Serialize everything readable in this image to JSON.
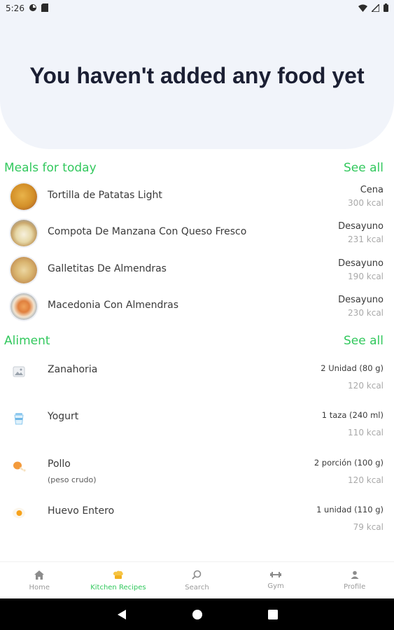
{
  "status_bar": {
    "time": "5:26"
  },
  "hero": {
    "title": "You haven't added any food yet"
  },
  "meals": {
    "title": "Meals for today",
    "see_all": "See all",
    "items": [
      {
        "name": "Tortilla de Patatas Light",
        "type": "Cena",
        "kcal": "300 kcal"
      },
      {
        "name": "Compota De Manzana Con Queso Fresco",
        "type": "Desayuno",
        "kcal": "231 kcal"
      },
      {
        "name": "Galletitas De Almendras",
        "type": "Desayuno",
        "kcal": "190 kcal"
      },
      {
        "name": "Macedonia Con Almendras",
        "type": "Desayuno",
        "kcal": "230 kcal"
      }
    ]
  },
  "aliment": {
    "title": "Aliment",
    "see_all": "See all",
    "items": [
      {
        "name": "Zanahoria",
        "sub": "",
        "portion": "2 Unidad (80 g)",
        "kcal": "120 kcal",
        "icon": "image-placeholder-icon"
      },
      {
        "name": "Yogurt",
        "sub": "",
        "portion": "1 taza (240 ml)",
        "kcal": "110 kcal",
        "icon": "yogurt-cup-icon"
      },
      {
        "name": "Pollo",
        "sub": "(peso crudo)",
        "portion": "2 porción (100 g)",
        "kcal": "120 kcal",
        "icon": "chicken-leg-icon"
      },
      {
        "name": "Huevo Entero",
        "sub": "",
        "portion": "1 unidad (110 g)",
        "kcal": "79 kcal",
        "icon": "egg-icon"
      }
    ]
  },
  "bottom_nav": {
    "items": [
      {
        "label": "Home",
        "icon": "home-icon",
        "active": false
      },
      {
        "label": "Kitchen Recipes",
        "icon": "chef-hat-icon",
        "active": true
      },
      {
        "label": "Search",
        "icon": "search-icon",
        "active": false
      },
      {
        "label": "Gym",
        "icon": "dumbbell-icon",
        "active": false
      },
      {
        "label": "Profile",
        "icon": "person-icon",
        "active": false
      }
    ]
  },
  "colors": {
    "accent": "#32c85d",
    "hero_bg": "#f1f4fa",
    "muted": "#a9a9a9"
  }
}
